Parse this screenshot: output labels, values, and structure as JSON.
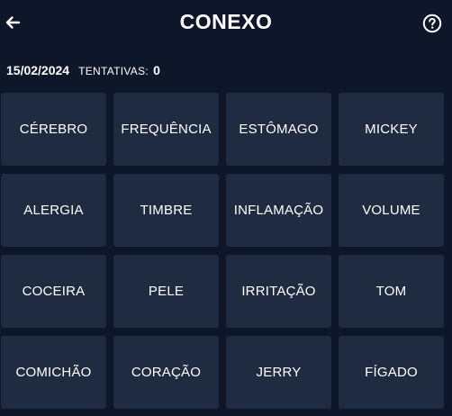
{
  "header": {
    "title": "CONEXO",
    "back_icon": "arrow-left-icon",
    "help_icon": "question-circle-icon"
  },
  "status": {
    "date": "15/02/2024",
    "attempts_label": "TENTATIVAS:",
    "attempts_value": "0"
  },
  "colors": {
    "background": "#0e1629",
    "tile": "#1f2b40",
    "text": "#ffffff"
  },
  "tiles": [
    "CÉREBRO",
    "FREQUÊNCIA",
    "ESTÔMAGO",
    "MICKEY",
    "ALERGIA",
    "TIMBRE",
    "INFLAMAÇÃO",
    "VOLUME",
    "COCEIRA",
    "PELE",
    "IRRITAÇÃO",
    "TOM",
    "COMICHÃO",
    "CORAÇÃO",
    "JERRY",
    "FÍGADO"
  ]
}
